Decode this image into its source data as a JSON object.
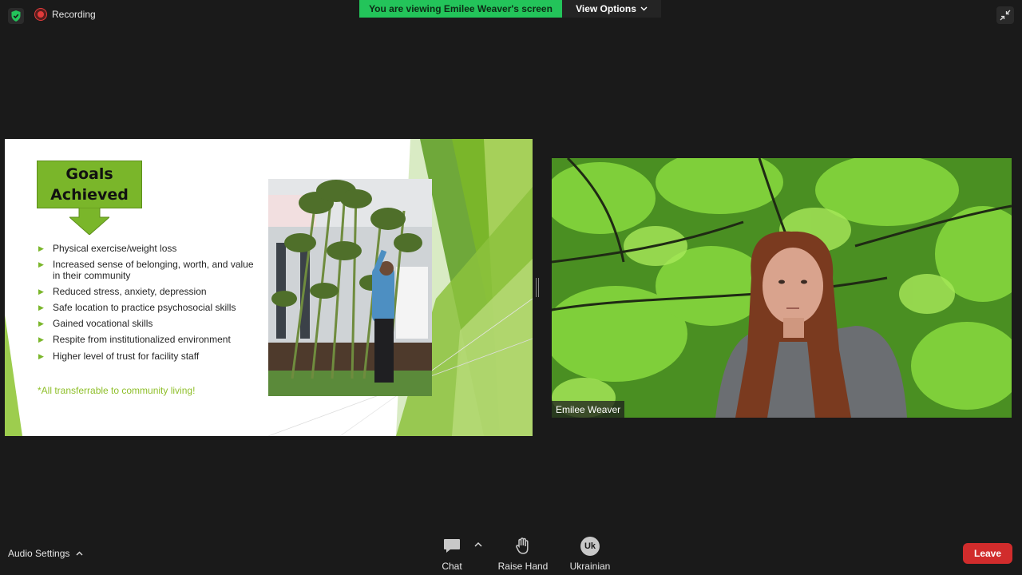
{
  "top_bar": {
    "recording_label": "Recording",
    "banner_text": "You are viewing Emilee Weaver's screen",
    "view_options_label": "View Options",
    "banner_color": "#23c45a"
  },
  "slide": {
    "title": "Goals\nAchieved",
    "bullets": [
      "Physical exercise/weight loss",
      "Increased sense of belonging, worth, and value in their community",
      "Reduced stress, anxiety, depression",
      "Safe location to practice psychosocial skills",
      "Gained vocational skills",
      "Respite from institutionalized environment",
      "Higher level of trust for facility staff"
    ],
    "note": "*All transferrable to community living!",
    "accent_color": "#7ab62a"
  },
  "participant": {
    "name": "Emilee Weaver"
  },
  "toolbar": {
    "audio_settings_label": "Audio Settings",
    "chat_label": "Chat",
    "raise_hand_label": "Raise Hand",
    "language_badge": "Uk",
    "language_label": "Ukrainian",
    "leave_label": "Leave",
    "leave_color": "#d12c2c"
  },
  "icons": {
    "security": "shield-check-icon",
    "recording": "record-icon",
    "view_options": "chevron-down-icon",
    "exit_fullscreen": "exit-fullscreen-icon",
    "chat": "chat-bubble-icon",
    "raise_hand": "hand-icon"
  }
}
